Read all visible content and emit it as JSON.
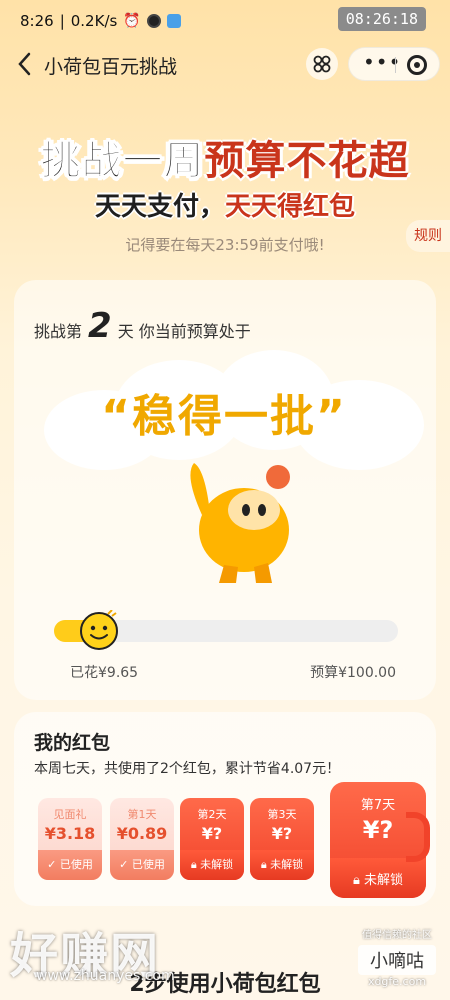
{
  "status_bar": {
    "time": "8:26",
    "net_speed": "0.2K/s",
    "clock_badge": "08:26:18"
  },
  "nav": {
    "title": "小荷包百元挑战"
  },
  "header": {
    "headline_part1": "挑战一周",
    "headline_part2": "预算不花超",
    "subline_part1": "天天支付，",
    "subline_part2": "天天得红包",
    "reminder": "记得要在每天23:59前支付哦!",
    "rules": "规则"
  },
  "challenge": {
    "prefix": "挑战第",
    "day": "2",
    "suffix": "天 你当前预算处于",
    "status": "“稳得一批”",
    "spent_label": "已花¥9.65",
    "budget_label": "预算¥100.00",
    "progress_fraction": 0.0965
  },
  "packets": {
    "title": "我的红包",
    "summary": "本周七天，共使用了2个红包，累计节省4.07元！",
    "items": [
      {
        "label": "见面礼",
        "amount": "¥3.18",
        "status": "已使用",
        "state": "used"
      },
      {
        "label": "第1天",
        "amount": "¥0.89",
        "status": "已使用",
        "state": "used"
      },
      {
        "label": "第2天",
        "amount": "¥?",
        "status": "未解锁",
        "state": "locked"
      },
      {
        "label": "第3天",
        "amount": "¥?",
        "status": "未解锁",
        "state": "locked"
      },
      {
        "label": "第7天",
        "amount": "¥?",
        "status": "未解锁",
        "state": "locked"
      }
    ]
  },
  "footer": {
    "heading": "2步使用小荷包红包"
  },
  "watermark": {
    "left_big": "好赚网",
    "left_url": "www.zhuanyes.com",
    "right_small": "值得信赖的社区",
    "right_box": "小嘀咕",
    "right_domain": "xdgfe.com"
  }
}
